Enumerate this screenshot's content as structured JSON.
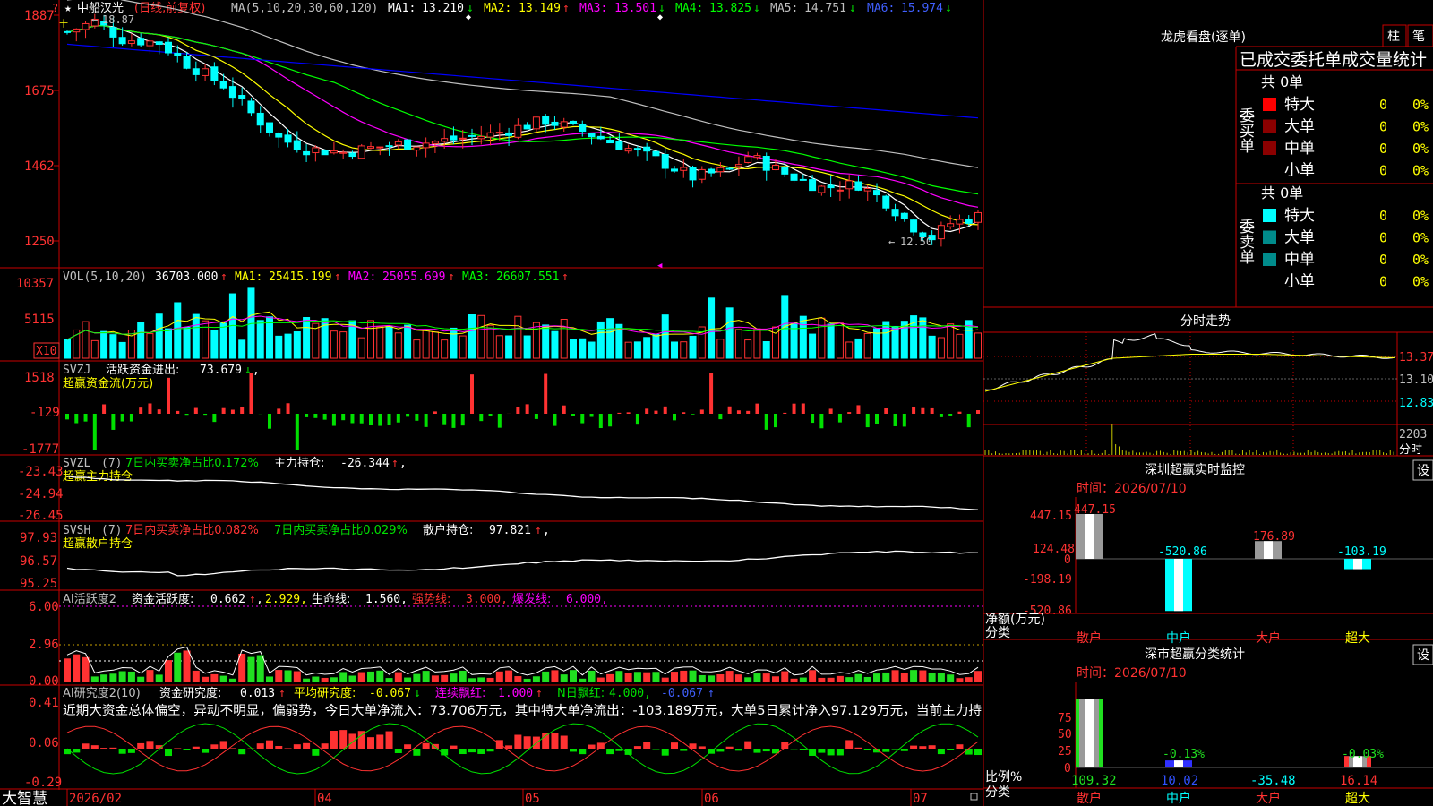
{
  "colors": {
    "up": "#ff3232",
    "down": "#00ffff",
    "green": "#00e000",
    "frame": "#c80000",
    "yellow": "#ffff00",
    "magenta": "#ff00ff",
    "ma4": "#00ff00",
    "ma5": "#c0c0c0",
    "ma6": "#0000ff",
    "white": "#ffffff",
    "blue_text": "#4060ff"
  },
  "main_chart": {
    "star": "★",
    "stock_name": "中船汉光",
    "period": "(日线,前复权)",
    "ma_header": "MA(5,10,20,30,60,120)",
    "ma1_label": "MA1:",
    "ma1_value": "13.210",
    "ma1_arrow": "↓",
    "ma2_label": "MA2:",
    "ma2_value": "13.149",
    "ma2_arrow": "↑",
    "ma3_label": "MA3:",
    "ma3_value": "13.501",
    "ma3_arrow": "↓",
    "ma4_label": "MA4:",
    "ma4_value": "13.825",
    "ma4_arrow": "↓",
    "ma5_label": "MA5:",
    "ma5_value": "14.751",
    "ma5_arrow": "↓",
    "ma6_label": "MA6:",
    "ma6_value": "15.974",
    "ma6_arrow": "↓",
    "price_axis": [
      "1887",
      "1675",
      "1462",
      "1250"
    ],
    "high_marker": "18.87",
    "low_marker": "12.50",
    "marker_arrow": "←"
  },
  "vol_panel": {
    "header": "VOL(5,10,20)",
    "vol_value": "36703.000",
    "vol_arrow": "↑",
    "ma1_label": "MA1:",
    "ma1_value": "25415.199",
    "ma1_arrow": "↑",
    "ma2_label": "MA2:",
    "ma2_value": "25055.699",
    "ma2_arrow": "↑",
    "ma3_label": "MA3:",
    "ma3_value": "26607.551",
    "ma3_arrow": "↑",
    "axis": [
      "10357",
      "5115"
    ],
    "unit": "X10"
  },
  "svzj_panel": {
    "name": "SVZJ",
    "label": "活跃资金进出:",
    "value": "73.679",
    "arrow": "↓",
    "comma": ",",
    "subtitle": "超赢资金流(万元)",
    "axis": [
      "1518",
      "-129",
      "-1777"
    ]
  },
  "svzl_panel": {
    "name": "SVZL",
    "param": "(7)",
    "stat1": "7日内买卖净占比0.172%",
    "label": "主力持仓:",
    "value": "-26.344",
    "arrow": "↑",
    "comma": ",",
    "subtitle": "超赢主力持仓",
    "axis": [
      "-23.43",
      "-24.94",
      "-26.45"
    ]
  },
  "svsh_panel": {
    "name": "SVSH",
    "param": "(7)",
    "stat1": "7日内买卖净占比0.082%",
    "stat2": "7日内买卖净占比0.029%",
    "label": "散户持仓:",
    "value": "97.821",
    "arrow": "↑",
    "comma": ",",
    "subtitle": "超赢散户持仓",
    "axis": [
      "97.93",
      "96.57",
      "95.25"
    ]
  },
  "ai_active": {
    "name": "AI活跃度2",
    "label": "资金活跃度:",
    "value": "0.662",
    "arrow": "↑",
    "comma": ",",
    "value2": "2.929,",
    "life_label": "生命线:",
    "life_value": "1.560,",
    "strong_label": "强势线:",
    "strong_value": "3.000,",
    "burst_label": "爆发线:",
    "burst_value": "6.000,",
    "axis": [
      "6.00",
      "2.96",
      "0.00"
    ]
  },
  "ai_research": {
    "name": "AI研究度2(10)",
    "label": "资金研究度:",
    "value": "0.013",
    "arrow": "↑",
    "avg_label": "平均研究度:",
    "avg_value": "-0.067",
    "avg_arrow": "↓",
    "red_label": "连续飘红:",
    "red_value": "1.000",
    "red_arrow": "↑",
    "nred_label": "N日飘红:",
    "nred_value": "4.000,",
    "tail_value": "-0.067",
    "tail_arrow": "↑",
    "comment": "近期大资金总体偏空，异动不明显，偏弱势，今日大单净流入：73.706万元，其中特大单净流出：-103.189万元，大单5日累计净入97.129万元，当前主力持",
    "axis": [
      "0.41",
      "0.06",
      "-0.29"
    ]
  },
  "bottom_bar": {
    "brand": "大智慧",
    "dates": [
      "2026/02",
      "04",
      "05",
      "06",
      "07"
    ]
  },
  "lhb": {
    "title": "龙虎看盘(逐单)",
    "btn1": "柱",
    "btn2": "笔",
    "section_title": "已成交委托单成交量统计",
    "buy_vertical": "委买单",
    "sell_vertical": "委卖单",
    "buy_total": "共 0单",
    "sell_total": "共 0单",
    "buy_rows": [
      {
        "label": "特大",
        "count": "0",
        "pct": "0%"
      },
      {
        "label": "大单",
        "count": "0",
        "pct": "0%"
      },
      {
        "label": "中单",
        "count": "0",
        "pct": "0%"
      },
      {
        "label": "小单",
        "count": "0",
        "pct": "0%"
      }
    ],
    "sell_rows": [
      {
        "label": "特大",
        "count": "0",
        "pct": "0%"
      },
      {
        "label": "大单",
        "count": "0",
        "pct": "0%"
      },
      {
        "label": "中单",
        "count": "0",
        "pct": "0%"
      },
      {
        "label": "小单",
        "count": "0",
        "pct": "0%"
      }
    ]
  },
  "intraday": {
    "title": "分时走势",
    "price_axis": [
      "13.37",
      "13.10",
      "12.83"
    ],
    "vol_label": "2203",
    "fs_label": "分时"
  },
  "sz_monitor": {
    "title": "深圳超赢实时监控",
    "setting": "设",
    "time_label": "时间：2026/07/10",
    "axis": [
      "447.15",
      "124.48",
      "0",
      "-198.19",
      "-520.86"
    ],
    "unit_label": "净额(万元)",
    "class_label": "分类",
    "bars": [
      {
        "name": "散户",
        "value": 447.15,
        "label": "447.15"
      },
      {
        "name": "中户",
        "value": -520.86,
        "label": "-520.86"
      },
      {
        "name": "大户",
        "value": 176.89,
        "label": "176.89"
      },
      {
        "name": "超大",
        "value": -103.19,
        "label": "-103.19"
      }
    ]
  },
  "sz_class": {
    "title": "深市超赢分类统计",
    "setting": "设",
    "time_label": "时间：2026/07/10",
    "axis": [
      "75",
      "50",
      "25",
      "0"
    ],
    "unit_label": "比例%",
    "class_label": "分类",
    "bars": [
      {
        "name": "散户",
        "pct": 109.32,
        "label": "109.32",
        "top_label": ""
      },
      {
        "name": "中户",
        "pct": 10.02,
        "label": "10.02",
        "top_label": "-0.13%"
      },
      {
        "name": "大户",
        "pct": -35.48,
        "label": "-35.48",
        "top_label": ""
      },
      {
        "name": "超大",
        "pct": 16.14,
        "label": "16.14",
        "top_label": "-0.03%"
      }
    ]
  }
}
